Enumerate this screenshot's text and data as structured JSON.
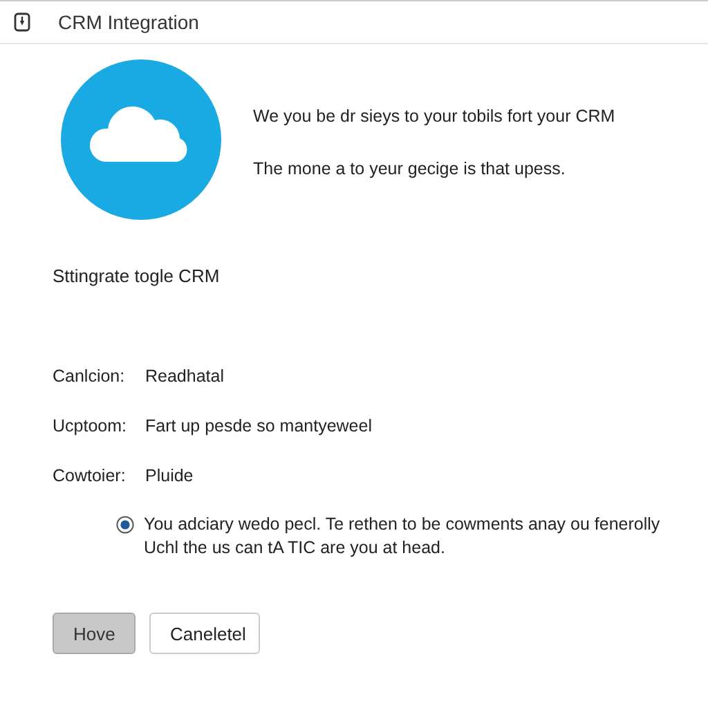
{
  "window": {
    "title": "CRM Integration"
  },
  "intro": {
    "lines": [
      "We you be dr sieys to your tobils fort your CRM",
      "The mone a to yeur gecige is that upess."
    ]
  },
  "heading": "Sttingrate togle CRM",
  "fields": [
    {
      "label": "Canlcion:",
      "value": "Readhatal"
    },
    {
      "label": "Ucptoom:",
      "value": "Fart up pesde so mantyeweel"
    },
    {
      "label": "Cowtoier:",
      "value": "Pluide"
    }
  ],
  "option": {
    "checked": true,
    "text": "You adciary wedo pecl. Te rethen to be cowments anay ou fenerolly Uchl the us can tA TIC are you at head."
  },
  "buttons": [
    {
      "label": "Hove",
      "kind": "primary"
    },
    {
      "label": "Caneletel",
      "kind": "secondary"
    }
  ]
}
